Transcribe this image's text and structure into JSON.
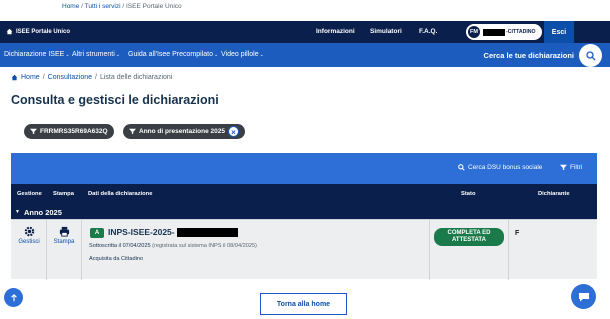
{
  "top_breadcrumb": {
    "home": "Home",
    "servizi": "Tutti i servizi",
    "current": "ISEE Portale Unico",
    "sep": "/"
  },
  "topbar": {
    "brand": "ISEE Portale Unico",
    "links": [
      "Informazioni",
      "Simulatori",
      "F.A.Q."
    ],
    "user_initials": "FM",
    "user_role": "-CITTADINO",
    "logout": "Esci"
  },
  "mainnav": {
    "items": [
      "Dichiarazione ISEE",
      "Altri strumenti",
      "Guida all'Isee Precompilato",
      "Video pillole"
    ],
    "search_label": "Cerca le tue dichiarazioni"
  },
  "breadcrumb": {
    "home": "Home",
    "consultazione": "Consultazione",
    "current": "Lista delle dichiarazioni",
    "sep": "/"
  },
  "page_title": "Consulta e gestisci le dichiarazioni",
  "filters": [
    {
      "label": "FRRMRS35R69A632Q",
      "removable": false
    },
    {
      "label": "Anno di presentazione 2025",
      "removable": true
    }
  ],
  "table_actions": {
    "search_dsu": "Cerca DSU bonus sociale",
    "filters": "Filtri"
  },
  "table": {
    "headers": [
      "Gestione",
      "Stampa",
      "Dati della dichiarazione",
      "Stato",
      "Dichiarante"
    ],
    "year_group": "Anno 2025",
    "rows": [
      {
        "gestione_label": "Gestisci",
        "stampa_label": "Stampa",
        "badge": "A",
        "protocol": "INPS-ISEE-2025-",
        "subscribed": "Sottoscritta il 07/04/2025",
        "registered": "(registrata sul sistema INPS il 08/04/2025)",
        "acquired": "Acquisita da Cittadino",
        "status_line1": "COMPLETA ED",
        "status_line2": "ATTESTATA",
        "dichiarante": "F"
      }
    ]
  },
  "home_button": "Torna alla home",
  "colors": {
    "navy": "#0b1f4c",
    "blue": "#1c5cbf",
    "bar": "#2d6fd6",
    "success": "#1a7a4a"
  }
}
